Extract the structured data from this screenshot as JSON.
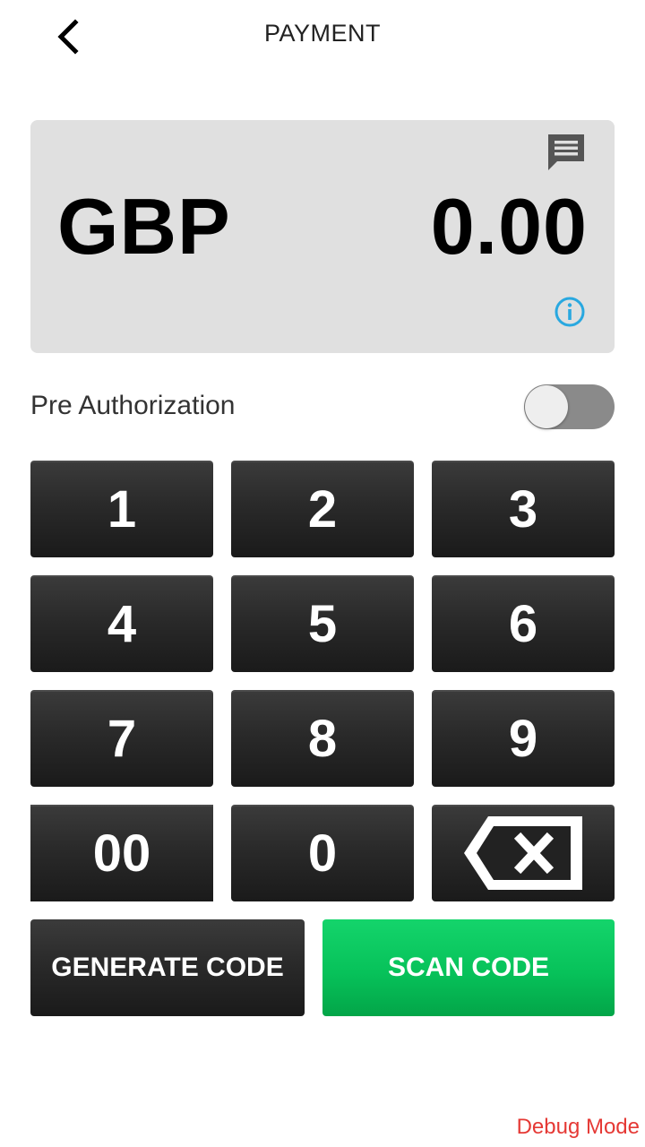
{
  "header": {
    "title": "PAYMENT",
    "back_icon": "chevron-left-icon"
  },
  "amount_panel": {
    "currency": "GBP",
    "amount": "0.00",
    "note_icon": "message-icon",
    "info_icon": "info-icon",
    "info_color": "#29a8e0"
  },
  "pre_authorization": {
    "label": "Pre Authorization",
    "enabled": false
  },
  "keypad": {
    "keys": [
      "1",
      "2",
      "3",
      "4",
      "5",
      "6",
      "7",
      "8",
      "9",
      "00",
      "0"
    ],
    "backspace_icon": "backspace-icon"
  },
  "actions": {
    "generate_label": "GENERATE CODE",
    "scan_label": "SCAN CODE",
    "scan_color": "#07c25a"
  },
  "footer": {
    "debug_label": "Debug Mode",
    "debug_color": "#e53935"
  }
}
